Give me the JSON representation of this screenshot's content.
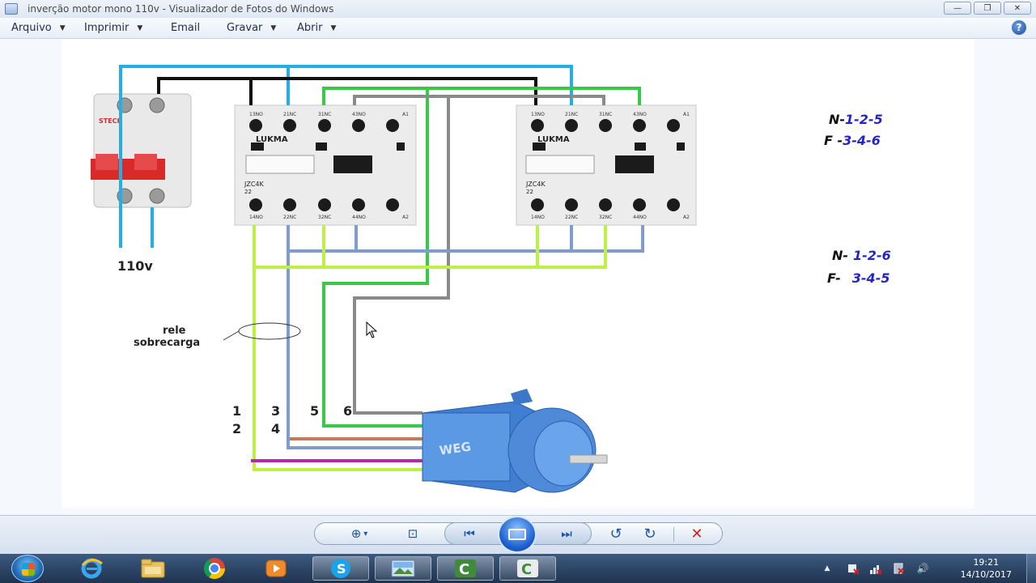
{
  "window": {
    "title": "inverção motor mono 110v - Visualizador de Fotos do Windows",
    "minimize_glyph": "—",
    "restore_glyph": "❐",
    "close_glyph": "✕"
  },
  "menu": {
    "items": [
      {
        "label": "Arquivo",
        "has_dropdown": true
      },
      {
        "label": "Imprimir",
        "has_dropdown": true
      },
      {
        "label": "Email",
        "has_dropdown": false
      },
      {
        "label": "Gravar",
        "has_dropdown": true
      },
      {
        "label": "Abrir",
        "has_dropdown": true
      }
    ],
    "help_glyph": "?"
  },
  "image": {
    "voltage_label": "110v",
    "relay_label_line1": "rele",
    "relay_label_line2": "sobrecarga",
    "breaker_brand": "STECK",
    "contactor_brand": "LUKMA",
    "contactor_model": "JZC4K",
    "contactor_model_sub": "22",
    "contactor_top_terminals": [
      "13NO",
      "21NC",
      "31NC",
      "43NO",
      "A1"
    ],
    "contactor_bottom_terminals": [
      "14NO",
      "22NC",
      "32NC",
      "44NO",
      "A2"
    ],
    "motor_brand": "WEG",
    "terminal_numbers_top": [
      "1",
      "3",
      "5",
      "6"
    ],
    "terminal_numbers_bottom": [
      "2",
      "4"
    ],
    "codes_set1": [
      {
        "key": "N-",
        "value": "1-2-5"
      },
      {
        "key": "F -",
        "value": "3-4-6"
      }
    ],
    "codes_set2": [
      {
        "key": "N-",
        "value": "1-2-6"
      },
      {
        "key": "F-",
        "value": "3-4-5"
      }
    ],
    "wire_colors": {
      "blue": "#23aee6",
      "black": "#111111",
      "green": "#38c94b",
      "gray": "#8a8a8a",
      "steel": "#7f9ccf",
      "lime": "#bff046",
      "brown": "#c27a57",
      "magenta": "#b22aa8"
    }
  },
  "controls": {
    "zoom_glyph": "⊕",
    "zoom_caret": "▾",
    "fit_glyph": "⊡",
    "prev_glyph": "⏮",
    "next_glyph": "⏭",
    "rotate_ccw_glyph": "↺",
    "rotate_cw_glyph": "↻",
    "delete_glyph": "✕"
  },
  "taskbar": {
    "time": "19:21",
    "date": "14/10/2017",
    "tray_up_glyph": "▲",
    "volume_glyph": "🔊"
  }
}
